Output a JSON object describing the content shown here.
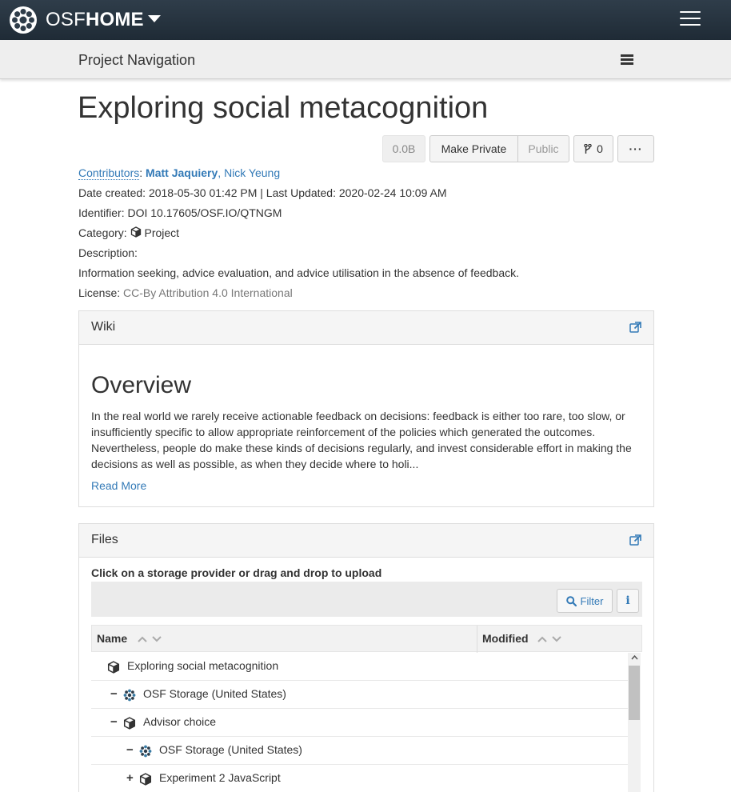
{
  "navbar": {
    "brand_osf": "OSF",
    "brand_home": "HOME"
  },
  "project_nav": {
    "title": "Project Navigation"
  },
  "project": {
    "title": "Exploring social metacognition",
    "size": "0.0B",
    "make_private_label": "Make Private",
    "public_label": "Public",
    "fork_count": "0",
    "more_label": "···"
  },
  "meta": {
    "contributors_label": "Contributors",
    "contributors_sep": ": ",
    "contributor_1": "Matt Jaquiery",
    "comma": ", ",
    "contributor_2": "Nick Yeung",
    "date_line": "Date created: 2018-05-30 01:42 PM | Last Updated: 2020-02-24 10:09 AM",
    "identifier_line": "Identifier: DOI 10.17605/OSF.IO/QTNGM",
    "category_label": "Category:",
    "category_value": "Project",
    "description_label": "Description:",
    "description": "Information seeking, advice evaluation, and advice utilisation in the absence of feedback.",
    "license_label": "License:",
    "license_value": "CC-By Attribution 4.0 International"
  },
  "wiki": {
    "title": "Wiki",
    "heading": "Overview",
    "text": "In the real world we rarely receive actionable feedback on decisions: feedback is either too rare, too slow, or insufficiently specific to allow appropriate reinforcement of the policies which generated the outcomes. Nevertheless, people do make these kinds of decisions regularly, and invest considerable effort in making the decisions as well as possible, as when they decide where to holi...",
    "read_more": "Read More"
  },
  "files": {
    "title": "Files",
    "hint": "Click on a storage provider or drag and drop to upload",
    "filter_label": "Filter",
    "info_label": "i",
    "col_name": "Name",
    "col_modified": "Modified",
    "rows": [
      {
        "toggle": "",
        "icon": "cube-icon",
        "label": "Exploring social metacognition"
      },
      {
        "toggle": "−",
        "icon": "osf-storage-icon",
        "label": "OSF Storage (United States)"
      },
      {
        "toggle": "−",
        "icon": "cube-icon",
        "label": "Advisor choice"
      },
      {
        "toggle": "−",
        "icon": "osf-storage-icon",
        "label": "OSF Storage (United States)"
      },
      {
        "toggle": "+",
        "icon": "cube-icon",
        "label": "Experiment 2 JavaScript"
      }
    ]
  },
  "colors": {
    "navbar": "#263947",
    "link": "#337ab7"
  }
}
